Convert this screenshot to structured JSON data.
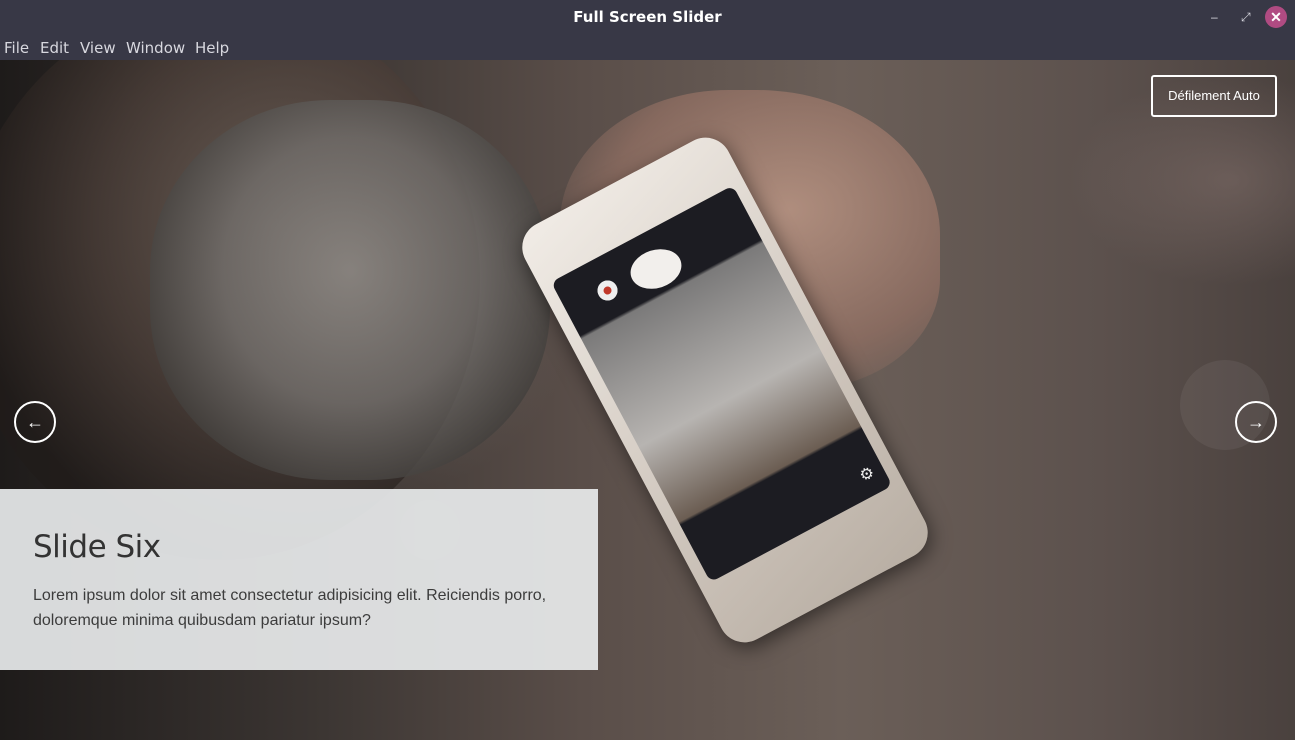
{
  "window": {
    "title": "Full Screen Slider",
    "controls": {
      "minimize": "–",
      "maximize": "⤢",
      "close": "✕"
    }
  },
  "menu": [
    "File",
    "Edit",
    "View",
    "Window",
    "Help"
  ],
  "slider": {
    "auto_scroll_label": "Défilement Auto",
    "prev_icon": "arrow-left-icon",
    "next_icon": "arrow-right-icon",
    "prev_glyph": "←",
    "next_glyph": "→",
    "caption": {
      "title": "Slide Six",
      "text": "Lorem ipsum dolor sit amet consectetur adipisicing elit. Reiciendis porro, doloremque minima quibusdam pariatur ipsum?"
    }
  },
  "colors": {
    "titlebar_bg": "#383846",
    "close_button": "#b04b82",
    "caption_bg": "#e8eaec"
  }
}
